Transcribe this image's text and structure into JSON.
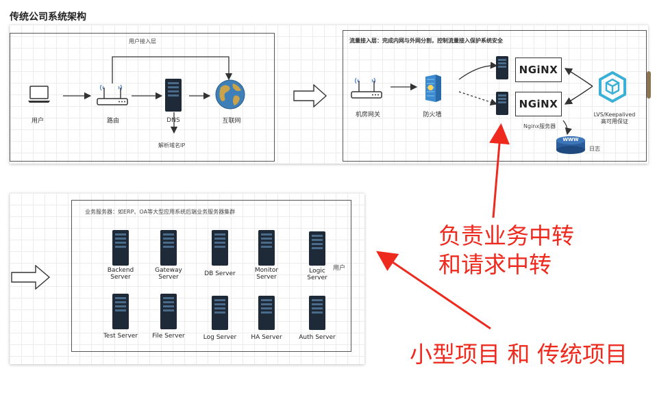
{
  "title": "传统公司系统架构",
  "top_left": {
    "layer_label": "用户接入层",
    "nodes": {
      "user": "用户",
      "router": "路由",
      "dns": "DNS",
      "internet": "互联网",
      "dns_note": "解析域名IP"
    }
  },
  "top_right": {
    "header": "流量接入层：完成内网与外网分割，控制流量接入保护系统安全",
    "nodes": {
      "gateway": "机房网关",
      "firewall": "防火墙",
      "nginx_logo": "NGiNX",
      "nginx_caption": "Nginx服务器",
      "lvs_line1": "LVS/Keepalived",
      "lvs_line2": "高可用保证",
      "log": "日志",
      "www": "WWW"
    }
  },
  "bottom": {
    "header": "业务服务器：如ERP、OA等大型应用系统后端业务服务器集群",
    "user_label": "用户",
    "servers_row1": [
      {
        "line1": "Backend",
        "line2": "Server"
      },
      {
        "line1": "Gateway",
        "line2": "Server"
      },
      {
        "line1": "DB Server",
        "line2": ""
      },
      {
        "line1": "Monitor",
        "line2": "Server"
      },
      {
        "line1": "Logic",
        "line2": "Server"
      }
    ],
    "servers_row2": [
      {
        "line1": "Test Server"
      },
      {
        "line1": "File Server"
      },
      {
        "line1": "Log Server"
      },
      {
        "line1": "HA Server"
      },
      {
        "line1": "Auth Server"
      }
    ]
  },
  "annotations": {
    "relay_line1": "负责业务中转",
    "relay_line2": "和请求中转",
    "project_types": "小型项目 和 传统项目"
  },
  "colors": {
    "annotation": "#ee2a1f",
    "server": "#1f2a38",
    "lvs": "#3bb0d6",
    "globe_sea": "#3f7fb8",
    "globe_land": "#c9a24a"
  }
}
